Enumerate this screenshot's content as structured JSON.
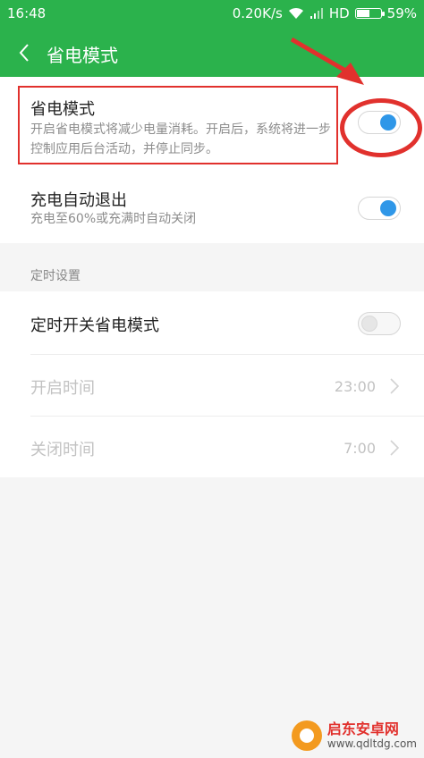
{
  "status_bar": {
    "time": "16:48",
    "speed": "0.20K/s",
    "network": "HD",
    "battery": "59%",
    "battery_level": 0.59
  },
  "app_bar": {
    "title": "省电模式"
  },
  "settings": {
    "power_saving": {
      "title": "省电模式",
      "description": "开启省电模式将减少电量消耗。开启后，系统将进一步控制应用后台活动，并停止同步。",
      "enabled": true
    },
    "auto_exit": {
      "title": "充电自动退出",
      "description": "充电至60%或充满时自动关闭",
      "enabled": true
    }
  },
  "schedule": {
    "header": "定时设置",
    "toggle": {
      "title": "定时开关省电模式",
      "enabled": false
    },
    "start": {
      "title": "开启时间",
      "value": "23:00"
    },
    "end": {
      "title": "关闭时间",
      "value": "7:00"
    }
  },
  "watermark": {
    "name": "启东安卓网",
    "url": "www.qdltdg.com"
  },
  "colors": {
    "accent": "#2bb24c",
    "switch_on": "#2f97e8",
    "annotation": "#e1312d"
  }
}
